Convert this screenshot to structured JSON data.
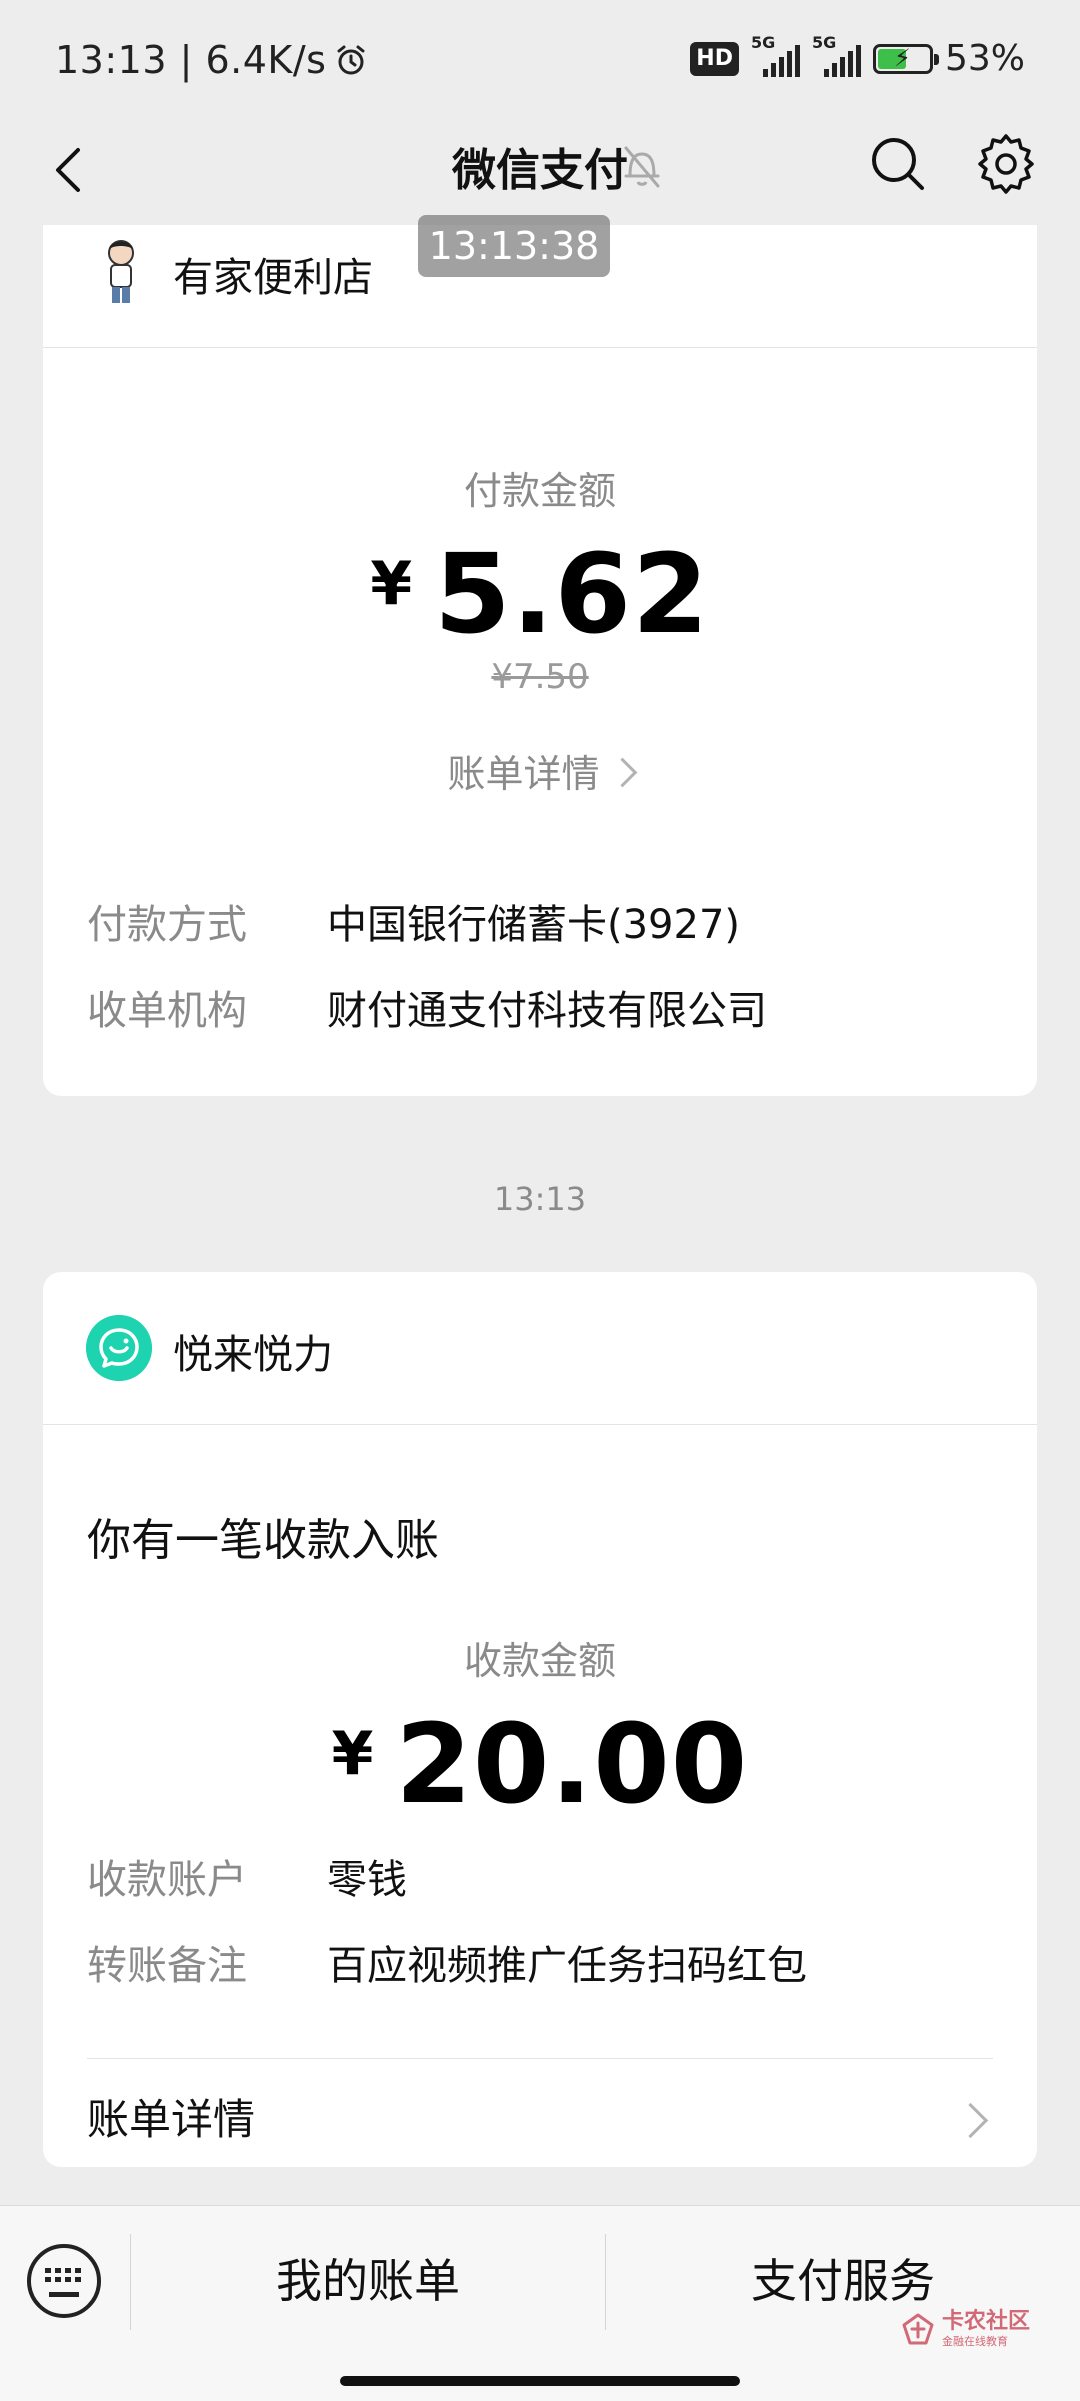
{
  "status_bar": {
    "time_speed": "13:13 | 6.4K/s",
    "hd_badge": "HD",
    "sim1_tag": "5G",
    "sim2_tag": "5G",
    "battery_percent": "53%"
  },
  "nav": {
    "title": "微信支付",
    "toast_time": "13:13:38"
  },
  "payment_card": {
    "merchant": "有家便利店",
    "amount_label": "付款金额",
    "currency": "¥",
    "amount": "5.62",
    "original_price": "¥7.50",
    "detail_link": "账单详情",
    "rows": [
      {
        "key": "付款方式",
        "value": "中国银行储蓄卡(3927)"
      },
      {
        "key": "收单机构",
        "value": "财付通支付科技有限公司"
      }
    ]
  },
  "time_separator": "13:13",
  "receipt_card": {
    "merchant": "悦来悦力",
    "notice": "你有一笔收款入账",
    "amount_label": "收款金额",
    "currency": "¥",
    "amount": "20.00",
    "rows": [
      {
        "key": "收款账户",
        "value": "零钱"
      },
      {
        "key": "转账备注",
        "value": "百应视频推广任务扫码红包"
      }
    ],
    "bill_detail": "账单详情"
  },
  "bottom_bar": {
    "my_bills": "我的账单",
    "pay_services": "支付服务",
    "watermark_main": "卡农社区",
    "watermark_sub": "金融在线教育"
  }
}
